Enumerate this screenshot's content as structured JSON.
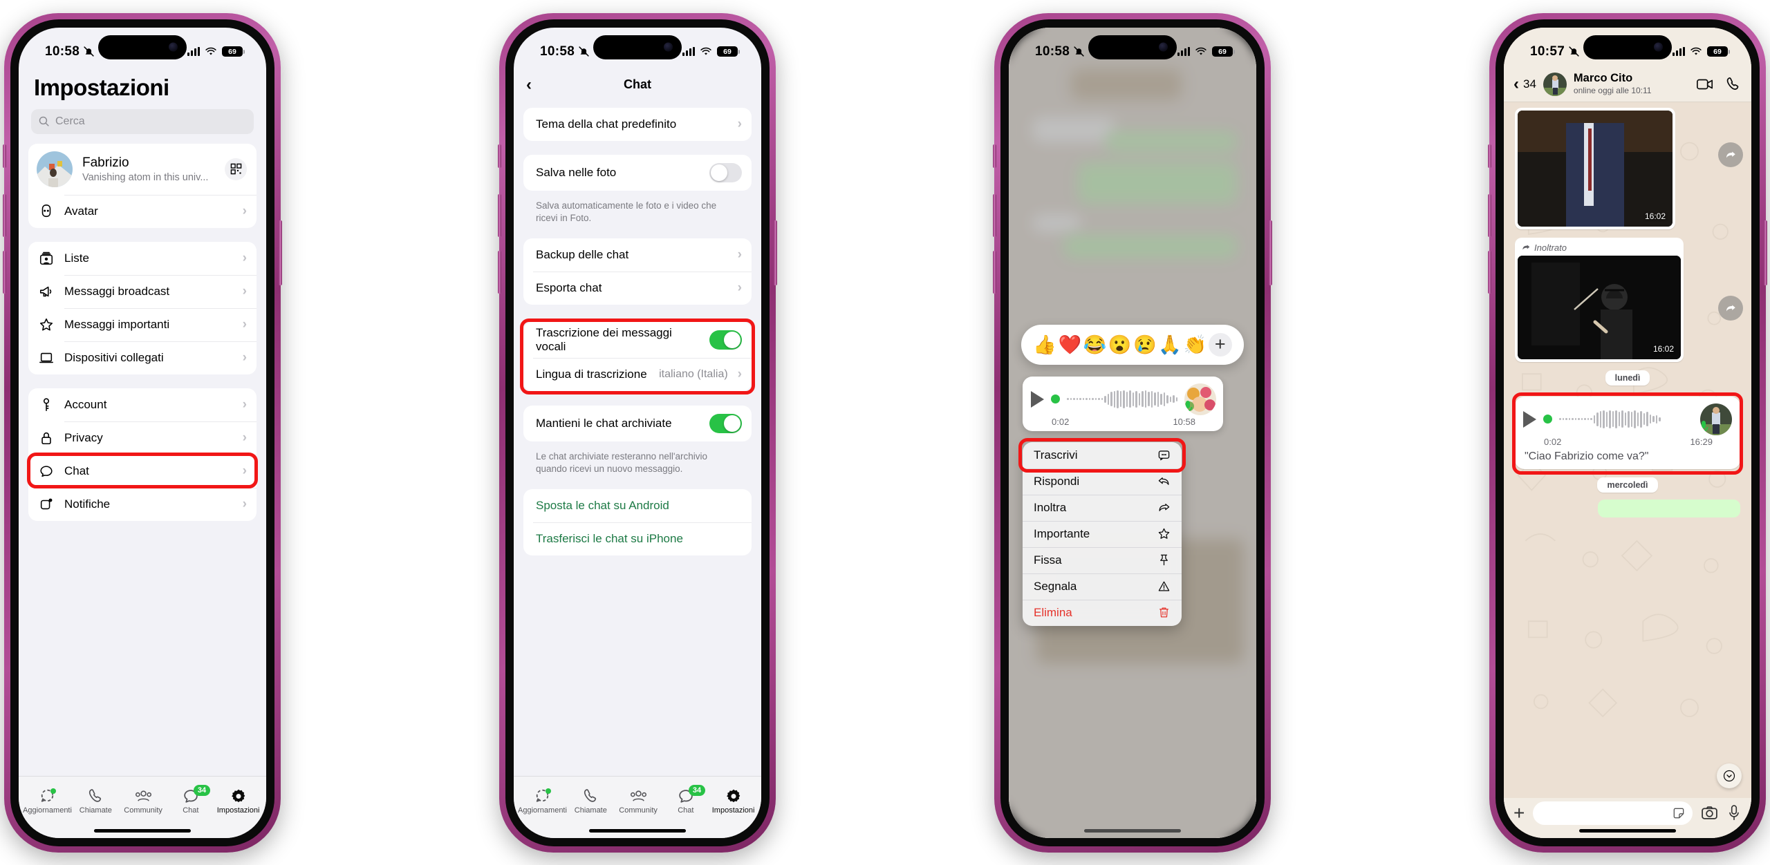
{
  "phone1": {
    "status": {
      "time": "10:58",
      "bell": "bell-slash-icon",
      "battery": "69"
    },
    "title": "Impostazioni",
    "search_placeholder": "Cerca",
    "profile": {
      "name": "Fabrizio",
      "status": "Vanishing atom in this univ...",
      "qr": "qr-code-icon"
    },
    "group_a": [
      {
        "label": "Avatar",
        "icon": "avatar-icon"
      }
    ],
    "group_b": [
      {
        "label": "Liste",
        "icon": "lists-icon"
      },
      {
        "label": "Messaggi broadcast",
        "icon": "megaphone-icon"
      },
      {
        "label": "Messaggi importanti",
        "icon": "star-icon"
      },
      {
        "label": "Dispositivi collegati",
        "icon": "laptop-icon"
      }
    ],
    "group_c": [
      {
        "label": "Account",
        "icon": "key-icon"
      },
      {
        "label": "Privacy",
        "icon": "lock-icon"
      },
      {
        "label": "Chat",
        "icon": "chat-bubble-icon"
      },
      {
        "label": "Notifiche",
        "icon": "notification-icon"
      }
    ],
    "tabs": [
      {
        "label": "Aggiornamenti",
        "icon": "updates-icon",
        "badge": "",
        "dot": true
      },
      {
        "label": "Chiamate",
        "icon": "phone-icon",
        "badge": ""
      },
      {
        "label": "Community",
        "icon": "community-icon",
        "badge": ""
      },
      {
        "label": "Chat",
        "icon": "chats-icon",
        "badge": "34"
      },
      {
        "label": "Impostazioni",
        "icon": "settings-gear-icon",
        "badge": "",
        "active": true
      }
    ]
  },
  "phone2": {
    "status": {
      "time": "10:58",
      "battery": "69"
    },
    "nav_title": "Chat",
    "back": "‹",
    "group_a": [
      {
        "label": "Tema della chat predefinito"
      }
    ],
    "save_photos": {
      "label": "Salva nelle foto",
      "on": false
    },
    "save_photos_note": "Salva automaticamente le foto e i video che ricevi in Foto.",
    "group_b": [
      {
        "label": "Backup delle chat"
      },
      {
        "label": "Esporta chat"
      }
    ],
    "transcription": {
      "toggle_label": "Trascrizione dei messaggi vocali",
      "toggle_on": true,
      "language_label": "Lingua di trascrizione",
      "language_value": "italiano (Italia)"
    },
    "archive": {
      "label": "Mantieni le chat archiviate",
      "on": true
    },
    "archive_note": "Le chat archiviate resteranno nell'archivio quando ricevi un nuovo messaggio.",
    "links": [
      "Sposta le chat su Android",
      "Trasferisci le chat su iPhone"
    ],
    "tabs": [
      {
        "label": "Aggiornamenti",
        "badge": ""
      },
      {
        "label": "Chiamate",
        "badge": ""
      },
      {
        "label": "Community",
        "badge": ""
      },
      {
        "label": "Chat",
        "badge": "34"
      },
      {
        "label": "Impostazioni",
        "badge": "",
        "active": true
      }
    ]
  },
  "phone3": {
    "status": {
      "time": "10:58",
      "battery": "69"
    },
    "reactions": [
      "👍",
      "❤️",
      "😂",
      "😮",
      "😢",
      "🙏",
      "👏"
    ],
    "add_reaction": "+",
    "voice": {
      "duration": "0:02",
      "time": "10:58"
    },
    "menu": [
      {
        "label": "Trascrivi",
        "icon": "transcribe-icon",
        "highlight": true
      },
      {
        "label": "Rispondi",
        "icon": "reply-icon"
      },
      {
        "label": "Inoltra",
        "icon": "forward-icon"
      },
      {
        "label": "Importante",
        "icon": "star-icon"
      },
      {
        "label": "Fissa",
        "icon": "pin-icon"
      },
      {
        "label": "Segnala",
        "icon": "report-icon"
      },
      {
        "label": "Elimina",
        "icon": "trash-icon",
        "danger": true
      }
    ]
  },
  "phone4": {
    "status": {
      "time": "10:57",
      "battery": "69"
    },
    "back_count": "34",
    "contact": {
      "name": "Marco Cito",
      "presence": "online oggi alle 10:11"
    },
    "actions": {
      "video": "video-call-icon",
      "call": "voice-call-icon"
    },
    "msg1": {
      "time": "16:02"
    },
    "forwarded_label": "Inoltrato",
    "msg2": {
      "time": "16:02"
    },
    "day1": "lunedì",
    "voice": {
      "duration": "0:02",
      "time": "16:29",
      "transcript": "\"Ciao Fabrizio come va?\""
    },
    "day2": "mercoledì",
    "composer": {
      "plus": "+",
      "sticker": "sticker-icon",
      "camera": "camera-icon",
      "mic": "microphone-icon"
    },
    "scroll_down": "chevron-down-icon"
  },
  "colors": {
    "highlight": "#f11616",
    "green": "#28c246",
    "link_green": "#1d7a45"
  }
}
